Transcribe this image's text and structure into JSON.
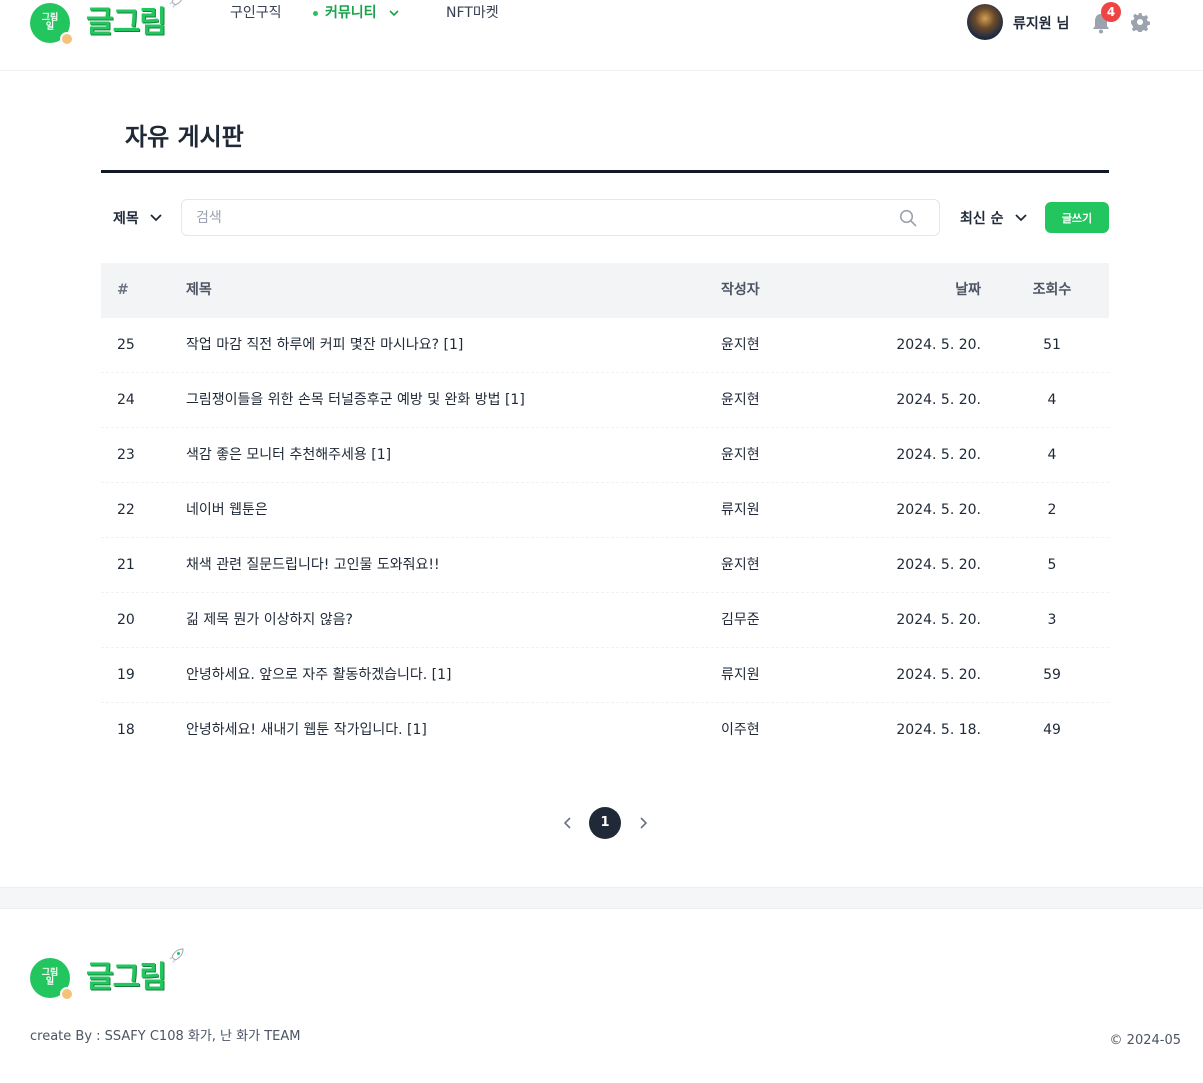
{
  "brand": {
    "badge_text": "그림\n일",
    "name": "글그림"
  },
  "nav": {
    "jobs": "구인구직",
    "community": "커뮤니티",
    "nft": "NFT마켓"
  },
  "user": {
    "name": "류지원 님",
    "notifications": "4"
  },
  "board": {
    "title": "자유 게시판",
    "filter": "제목",
    "search_placeholder": "검색",
    "sort": "최신 순",
    "write_label": "글쓰기",
    "columns": {
      "num": "#",
      "title": "제목",
      "author": "작성자",
      "date": "날짜",
      "views": "조회수"
    },
    "rows": [
      {
        "num": "25",
        "title": "작업 마감 직전 하루에 커피 몇잔 마시나요? [1]",
        "author": "윤지현",
        "date": "2024. 5. 20.",
        "views": "51"
      },
      {
        "num": "24",
        "title": "그림쟁이들을 위한 손목 터널증후군 예방 및 완화 방법 [1]",
        "author": "윤지현",
        "date": "2024. 5. 20.",
        "views": "4"
      },
      {
        "num": "23",
        "title": "색감 좋은 모니터 추천해주세용 [1]",
        "author": "윤지현",
        "date": "2024. 5. 20.",
        "views": "4"
      },
      {
        "num": "22",
        "title": "네이버 웹툰은",
        "author": "류지원",
        "date": "2024. 5. 20.",
        "views": "2"
      },
      {
        "num": "21",
        "title": "채색 관련 질문드립니다! 고인물 도와줘요!!",
        "author": "윤지현",
        "date": "2024. 5. 20.",
        "views": "5"
      },
      {
        "num": "20",
        "title": "긺 제목 뭔가 이상하지 않음?",
        "author": "김무준",
        "date": "2024. 5. 20.",
        "views": "3"
      },
      {
        "num": "19",
        "title": "안녕하세요. 앞으로 자주 활동하겠습니다. [1]",
        "author": "류지원",
        "date": "2024. 5. 20.",
        "views": "59"
      },
      {
        "num": "18",
        "title": "안녕하세요! 새내기 웹툰 작가입니다. [1]",
        "author": "이주현",
        "date": "2024. 5. 18.",
        "views": "49"
      }
    ],
    "page_current": "1"
  },
  "footer": {
    "credit": "create By : SSAFY C108 화가, 난 화가 TEAM",
    "copyright": "© 2024-05"
  },
  "colors": {
    "accent": "#22c55e",
    "dark": "#1f2937",
    "badge": "#ef4444"
  }
}
